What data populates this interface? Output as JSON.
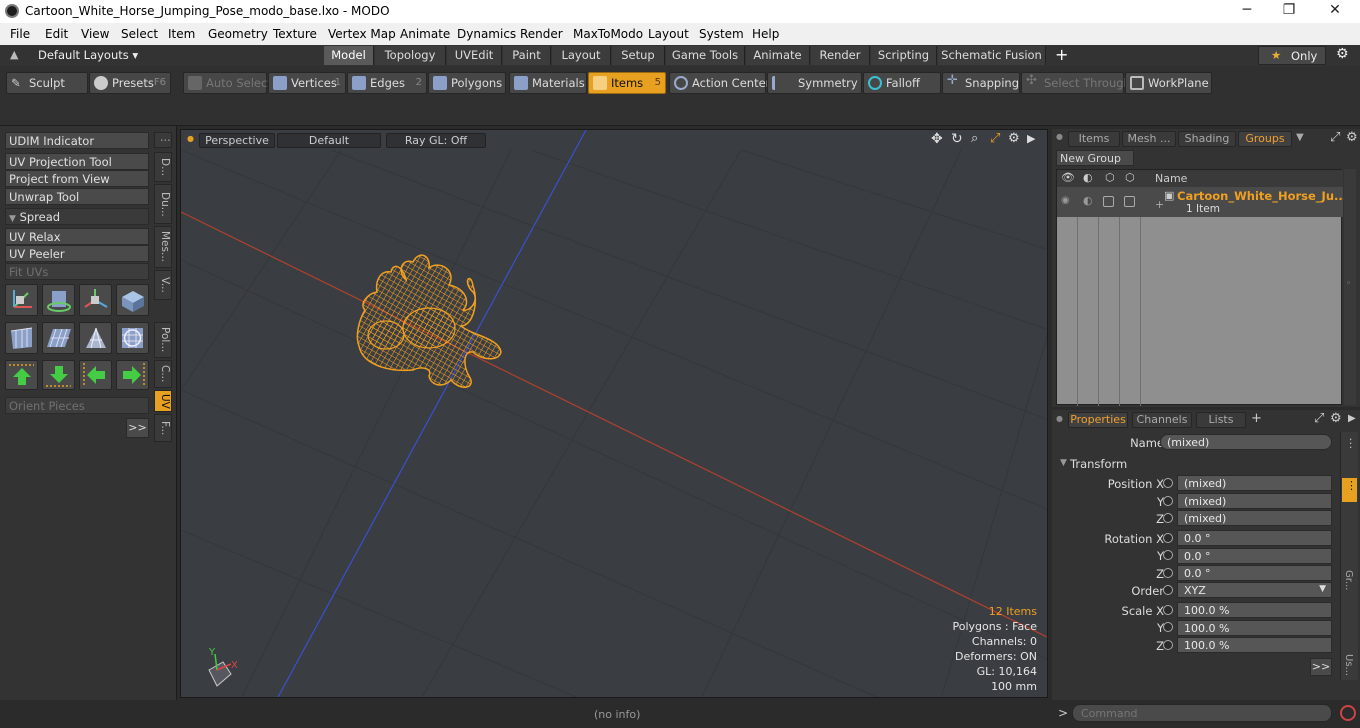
{
  "window": {
    "title": "Cartoon_White_Horse_Jumping_Pose_modo_base.lxo - MODO",
    "minimize": "─",
    "maximize": "❐",
    "close": "✕"
  },
  "menu": [
    "File",
    "Edit",
    "View",
    "Select",
    "Item",
    "Geometry",
    "Texture",
    "Vertex Map",
    "Animate",
    "Dynamics",
    "Render",
    "MaxToModo",
    "Layout",
    "System",
    "Help"
  ],
  "layouts": {
    "dropdown": "Default Layouts",
    "tabs": [
      "Model",
      "Topology",
      "UVEdit",
      "Paint",
      "Layout",
      "Setup",
      "Game Tools",
      "Animate",
      "Render",
      "Scripting",
      "Schematic Fusion"
    ],
    "active_tab": "Model",
    "add": "+",
    "only": "Only",
    "gear": "⚙"
  },
  "toolbar": {
    "sculpt": "Sculpt",
    "presets": "Presets",
    "presets_key": "F6",
    "auto_select": "Auto Select",
    "vertices": "Vertices",
    "vertices_key": "1",
    "edges": "Edges",
    "edges_key": "2",
    "polygons": "Polygons",
    "materials": "Materials",
    "items": "Items",
    "items_key": "5",
    "action_center": "Action Center",
    "symmetry": "Symmetry",
    "falloff": "Falloff",
    "snapping": "Snapping",
    "select_through": "Select Through",
    "workplane": "WorkPlane"
  },
  "left_panel": {
    "udim": "UDIM Indicator",
    "uv_projection": "UV Projection Tool",
    "project_from_view": "Project from View",
    "unwrap": "Unwrap Tool",
    "spread": "Spread",
    "uv_relax": "UV Relax",
    "uv_peeler": "UV Peeler",
    "fit_uvs": "Fit UVs",
    "orient_pieces": "Orient Pieces",
    "more": ">>",
    "vtabs": [
      "D...",
      "Du...",
      "Mes...",
      "V...",
      "Pol...",
      "C...",
      "UV",
      "F..."
    ],
    "vtab_active": "UV"
  },
  "viewport": {
    "view": "Perspective",
    "shading": "Default",
    "raygl": "Ray GL: Off",
    "info": {
      "items": "12 Items",
      "polygons": "Polygons : Face",
      "channels": "Channels: 0",
      "deformers": "Deformers: ON",
      "gl": "GL: 10,164",
      "units": "100 mm"
    },
    "axis_y": "Y",
    "axis_x": "X"
  },
  "groups_panel": {
    "tabs": [
      "Items",
      "Mesh ...",
      "Shading",
      "Groups"
    ],
    "active_tab": "Groups",
    "new_group": "New Group",
    "col_name": "Name",
    "row_name": "Cartoon_White_Horse_Ju...",
    "row_sub": "1 Item"
  },
  "properties_panel": {
    "tabs": [
      "Properties",
      "Channels",
      "Lists"
    ],
    "active_tab": "Properties",
    "add": "+",
    "name_label": "Name",
    "name_value": "(mixed)",
    "transform": "Transform",
    "position_label": "Position X",
    "pos_x": "(mixed)",
    "pos_y": "(mixed)",
    "pos_z": "(mixed)",
    "rotation_label": "Rotation X",
    "rot_x": "0.0 °",
    "rot_y": "0.0 °",
    "rot_z": "0.0 °",
    "order_label": "Order",
    "order_value": "XYZ",
    "scale_label": "Scale X",
    "scl_x": "100.0 %",
    "scl_y": "100.0 %",
    "scl_z": "100.0 %",
    "y": "Y",
    "z": "Z",
    "more": ">>",
    "side_gr": "Gr...",
    "side_us": "Us..."
  },
  "status": {
    "info": "(no info)",
    "command_prompt": ">",
    "command_placeholder": "Command"
  },
  "colors": {
    "accent": "#e8a020",
    "wire": "#f0a020",
    "viewport_bg": "#3a3d42",
    "axis_red": "#c0392b",
    "axis_blue": "#3b4fd0"
  }
}
